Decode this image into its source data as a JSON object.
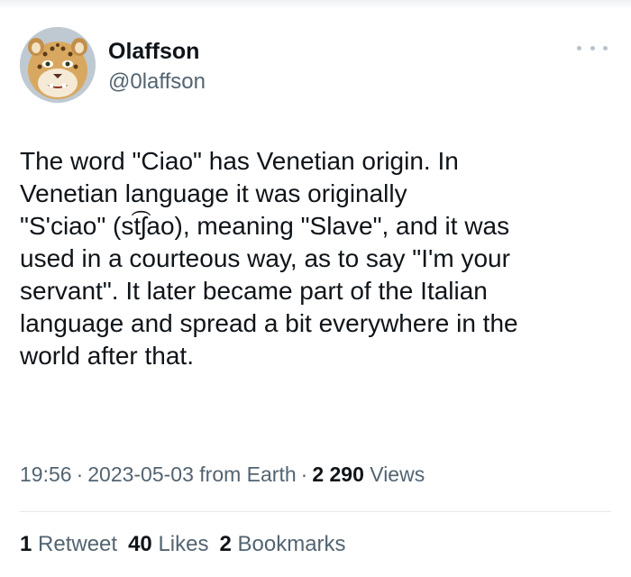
{
  "author": {
    "display_name": "Olaffson",
    "handle": "@0laffson",
    "avatar": "leopard-avatar"
  },
  "tweet": {
    "lines": [
      "The word \"Ciao\" has Venetian origin. In",
      "Venetian language it was originally",
      "\"S'ciao\" (st͡ʃao), meaning \"Slave\", and it was",
      "used in a courteous way, as to say \"I'm your",
      "servant\". It later became part of the Italian",
      "language and spread a bit everywhere in the",
      "world after that."
    ]
  },
  "meta": {
    "time": "19:56",
    "separator": "·",
    "date_source": "2023-05-03 from Earth",
    "views_count": "2 290",
    "views_label": "Views"
  },
  "stats": {
    "retweets_count": "1",
    "retweets_label": "Retweet",
    "likes_count": "40",
    "likes_label": "Likes",
    "bookmarks_count": "2",
    "bookmarks_label": "Bookmarks"
  },
  "icons": {
    "more": "more-icon"
  }
}
